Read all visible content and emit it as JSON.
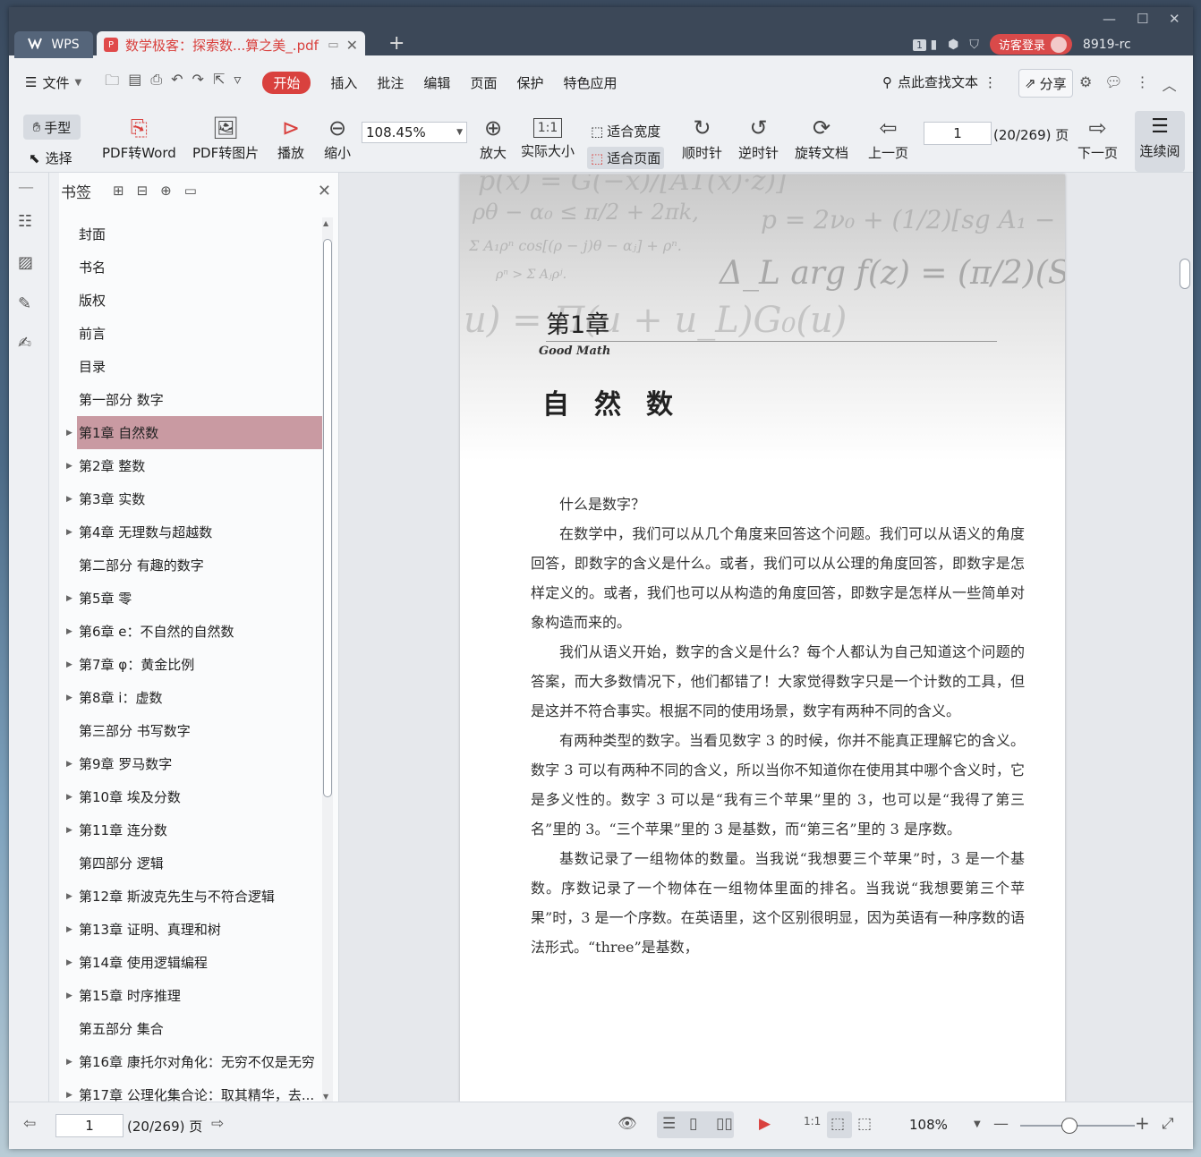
{
  "titlebar": {
    "app_tab": "WPS",
    "doc_tab": "数学极客：探索数...算之美_.pdf",
    "badge_count": "1",
    "login": "访客登录",
    "user_id": "8919-rc"
  },
  "menubar": {
    "file": "文件",
    "tabs": [
      "开始",
      "插入",
      "批注",
      "编辑",
      "页面",
      "保护",
      "特色应用"
    ],
    "search": "点此查找文本",
    "share": "分享"
  },
  "ribbon": {
    "hand": "手型",
    "select": "选择",
    "pdf_to_word": "PDF转Word",
    "pdf_to_image": "PDF转图片",
    "play": "播放",
    "zoom_out": "缩小",
    "zoom_value": "108.45%",
    "zoom_in": "放大",
    "actual_size": "实际大小",
    "fit_width": "适合宽度",
    "fit_page": "适合页面",
    "rotate_cw": "顺时针",
    "rotate_ccw": "逆时针",
    "rotate_doc": "旋转文档",
    "prev_page": "上一页",
    "page_input": "1",
    "page_total": "(20/269) 页",
    "next_page": "下一页",
    "continuous": "连续阅"
  },
  "bookmarks": {
    "title": "书签",
    "items": [
      {
        "label": "封面",
        "expandable": false
      },
      {
        "label": "书名",
        "expandable": false
      },
      {
        "label": "版权",
        "expandable": false
      },
      {
        "label": "前言",
        "expandable": false
      },
      {
        "label": "目录",
        "expandable": false
      },
      {
        "label": "第一部分 数字",
        "expandable": false
      },
      {
        "label": "第1章 自然数",
        "expandable": true,
        "selected": true
      },
      {
        "label": "第2章 整数",
        "expandable": true
      },
      {
        "label": "第3章 实数",
        "expandable": true
      },
      {
        "label": "第4章 无理数与超越数",
        "expandable": true
      },
      {
        "label": "第二部分 有趣的数字",
        "expandable": false
      },
      {
        "label": "第5章 零",
        "expandable": true
      },
      {
        "label": "第6章 e：不自然的自然数",
        "expandable": true
      },
      {
        "label": "第7章 φ：黄金比例",
        "expandable": true
      },
      {
        "label": "第8章 i：虚数",
        "expandable": true
      },
      {
        "label": "第三部分 书写数字",
        "expandable": false
      },
      {
        "label": "第9章 罗马数字",
        "expandable": true
      },
      {
        "label": "第10章 埃及分数",
        "expandable": true
      },
      {
        "label": "第11章 连分数",
        "expandable": true
      },
      {
        "label": "第四部分 逻辑",
        "expandable": false
      },
      {
        "label": "第12章 斯波克先生与不符合逻辑",
        "expandable": true
      },
      {
        "label": "第13章 证明、真理和树",
        "expandable": true
      },
      {
        "label": "第14章 使用逻辑编程",
        "expandable": true
      },
      {
        "label": "第15章 时序推理",
        "expandable": true
      },
      {
        "label": "第五部分 集合",
        "expandable": false
      },
      {
        "label": "第16章 康托尔对角化：无穷不仅是无穷",
        "expandable": true
      },
      {
        "label": "第17章 公理化集合论：取其精华，去...",
        "expandable": true
      }
    ]
  },
  "page": {
    "formulas": [
      "p(x) = G(−x)/[A1(x)·z)]",
      "ρθ − α₀ ≤ π/2 + 2πk,",
      "p = 2ν₀ + (1/2)[sg A₁ −",
      "Σ A₁ρⁿ cos[(ρ − j)θ − αⱼ] + ρⁿ.",
      "ρⁿ > Σ Aⱼρʲ.",
      "Δ_L arg f(z) = (π/2)(S",
      "u) = Π(u + u_L)G₀(u)"
    ],
    "chapter_no": "第1章",
    "good_math": "Good Math",
    "chapter_title": "自然数",
    "paragraphs": [
      "什么是数字？",
      "在数学中，我们可以从几个角度来回答这个问题。我们可以从语义的角度回答，即数字的含义是什么。或者，我们可以从公理的角度回答，即数字是怎样定义的。或者，我们也可以从构造的角度回答，即数字是怎样从一些简单对象构造而来的。",
      "我们从语义开始，数字的含义是什么？每个人都认为自己知道这个问题的答案，而大多数情况下，他们都错了！大家觉得数字只是一个计数的工具，但是这并不符合事实。根据不同的使用场景，数字有两种不同的含义。",
      "有两种类型的数字。当看见数字 3 的时候，你并不能真正理解它的含义。数字 3 可以有两种不同的含义，所以当你不知道你在使用其中哪个含义时，它是多义性的。数字 3 可以是“我有三个苹果”里的 3，也可以是“我得了第三名”里的 3。“三个苹果”里的 3 是基数，而“第三名”里的 3 是序数。",
      "基数记录了一组物体的数量。当我说“我想要三个苹果”时，3 是一个基数。序数记录了一个物体在一组物体里面的排名。当我说“我想要第三个苹果”时，3 是一个序数。在英语里，这个区别很明显，因为英语有一种序数的语法形式。“three”是基数，"
    ]
  },
  "statusbar": {
    "page_input": "1",
    "page_total": "(20/269) 页",
    "zoom": "108%",
    "zoom_level_percent": 108
  },
  "colors": {
    "accent": "#d9413e",
    "selection": "#c99aa2",
    "titlebar": "#3c4858"
  }
}
